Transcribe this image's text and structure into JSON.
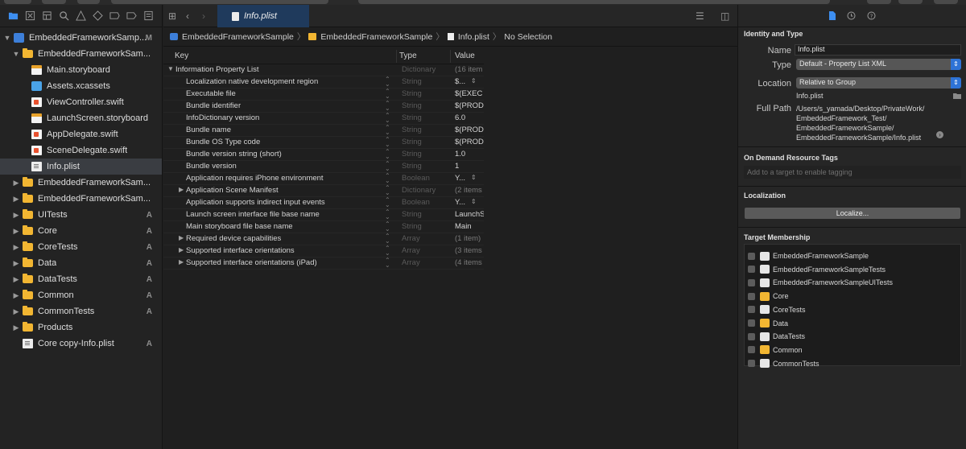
{
  "navigator": {
    "tree": [
      {
        "label": "EmbeddedFrameworkSamp...",
        "icon": "project-icon",
        "badge": "M",
        "expanded": true,
        "level": 0
      },
      {
        "label": "EmbeddedFrameworkSam...",
        "icon": "folder-icon",
        "badge": "",
        "expanded": true,
        "level": 1
      },
      {
        "label": "Main.storyboard",
        "icon": "storyboard-icon",
        "badge": "",
        "level": 2
      },
      {
        "label": "Assets.xcassets",
        "icon": "asset-catalog-icon",
        "badge": "",
        "level": 2
      },
      {
        "label": "ViewController.swift",
        "icon": "swift-file-icon",
        "badge": "",
        "level": 2
      },
      {
        "label": "LaunchScreen.storyboard",
        "icon": "storyboard-icon",
        "badge": "",
        "level": 2
      },
      {
        "label": "AppDelegate.swift",
        "icon": "swift-file-icon",
        "badge": "",
        "level": 2
      },
      {
        "label": "SceneDelegate.swift",
        "icon": "swift-file-icon",
        "badge": "",
        "level": 2
      },
      {
        "label": "Info.plist",
        "icon": "plist-file-icon",
        "badge": "",
        "level": 2,
        "selected": true
      },
      {
        "label": "EmbeddedFrameworkSam...",
        "icon": "folder-icon",
        "badge": "",
        "collapsed": true,
        "level": 1
      },
      {
        "label": "EmbeddedFrameworkSam...",
        "icon": "folder-icon",
        "badge": "",
        "collapsed": true,
        "level": 1
      },
      {
        "label": "UITests",
        "icon": "folder-icon",
        "badge": "A",
        "collapsed": true,
        "level": 1
      },
      {
        "label": "Core",
        "icon": "folder-icon",
        "badge": "A",
        "collapsed": true,
        "level": 1
      },
      {
        "label": "CoreTests",
        "icon": "folder-icon",
        "badge": "A",
        "collapsed": true,
        "level": 1
      },
      {
        "label": "Data",
        "icon": "folder-icon",
        "badge": "A",
        "collapsed": true,
        "level": 1
      },
      {
        "label": "DataTests",
        "icon": "folder-icon",
        "badge": "A",
        "collapsed": true,
        "level": 1
      },
      {
        "label": "Common",
        "icon": "folder-icon",
        "badge": "A",
        "collapsed": true,
        "level": 1
      },
      {
        "label": "CommonTests",
        "icon": "folder-icon",
        "badge": "A",
        "collapsed": true,
        "level": 1
      },
      {
        "label": "Products",
        "icon": "folder-icon",
        "badge": "",
        "collapsed": true,
        "level": 1
      },
      {
        "label": "Core copy-Info.plist",
        "icon": "plist-file-icon",
        "badge": "A",
        "level": 1
      }
    ]
  },
  "editor": {
    "tab_label": "Info.plist",
    "breadcrumbs": [
      "EmbeddedFrameworkSample",
      "EmbeddedFrameworkSample",
      "Info.plist",
      "No Selection"
    ],
    "columns": {
      "key": "Key",
      "type": "Type",
      "value": "Value"
    },
    "rows": [
      {
        "key": "Information Property List",
        "type": "Dictionary",
        "value": "(16 item",
        "disclosure": "open",
        "root": true
      },
      {
        "key": "Localization native development region",
        "type": "String",
        "value": "$...",
        "stepper": true
      },
      {
        "key": "Executable file",
        "type": "String",
        "value": "$(EXEC"
      },
      {
        "key": "Bundle identifier",
        "type": "String",
        "value": "$(PROD"
      },
      {
        "key": "InfoDictionary version",
        "type": "String",
        "value": "6.0"
      },
      {
        "key": "Bundle name",
        "type": "String",
        "value": "$(PROD"
      },
      {
        "key": "Bundle OS Type code",
        "type": "String",
        "value": "$(PROD"
      },
      {
        "key": "Bundle version string (short)",
        "type": "String",
        "value": "1.0"
      },
      {
        "key": "Bundle version",
        "type": "String",
        "value": "1"
      },
      {
        "key": "Application requires iPhone environment",
        "type": "Boolean",
        "value": "Y...",
        "stepper": true
      },
      {
        "key": "Application Scene Manifest",
        "type": "Dictionary",
        "value": "(2 items",
        "disclosure": "closed"
      },
      {
        "key": "Application supports indirect input events",
        "type": "Boolean",
        "value": "Y...",
        "stepper": true
      },
      {
        "key": "Launch screen interface file base name",
        "type": "String",
        "value": "LaunchS"
      },
      {
        "key": "Main storyboard file base name",
        "type": "String",
        "value": "Main"
      },
      {
        "key": "Required device capabilities",
        "type": "Array",
        "value": "(1 item)",
        "disclosure": "closed"
      },
      {
        "key": "Supported interface orientations",
        "type": "Array",
        "value": "(3 items",
        "disclosure": "closed"
      },
      {
        "key": "Supported interface orientations (iPad)",
        "type": "Array",
        "value": "(4 items",
        "disclosure": "closed"
      }
    ]
  },
  "inspector": {
    "identity": {
      "title": "Identity and Type",
      "name_label": "Name",
      "name_value": "Info.plist",
      "type_label": "Type",
      "type_value": "Default - Property List XML",
      "location_label": "Location",
      "location_value": "Relative to Group",
      "location_file": "Info.plist",
      "fullpath_label": "Full Path",
      "fullpath_lines": [
        "/Users/s_yamada/Desktop/PrivateWork/",
        "EmbeddedFramework_Test/",
        "EmbeddedFrameworkSample/",
        "EmbeddedFrameworkSample/Info.plist"
      ]
    },
    "odr": {
      "title": "On Demand Resource Tags",
      "placeholder": "Add to a target to enable tagging"
    },
    "localization": {
      "title": "Localization",
      "button": "Localize..."
    },
    "membership": {
      "title": "Target Membership",
      "targets": [
        {
          "label": "EmbeddedFrameworkSample",
          "kind": "app",
          "checked": false
        },
        {
          "label": "EmbeddedFrameworkSampleTests",
          "kind": "test",
          "checked": false
        },
        {
          "label": "EmbeddedFrameworkSampleUITests",
          "kind": "test",
          "checked": false
        },
        {
          "label": "Core",
          "kind": "framework",
          "checked": false
        },
        {
          "label": "CoreTests",
          "kind": "test",
          "checked": false
        },
        {
          "label": "Data",
          "kind": "framework",
          "checked": false
        },
        {
          "label": "DataTests",
          "kind": "test",
          "checked": false
        },
        {
          "label": "Common",
          "kind": "framework",
          "checked": false
        },
        {
          "label": "CommonTests",
          "kind": "test",
          "checked": false
        }
      ]
    }
  }
}
